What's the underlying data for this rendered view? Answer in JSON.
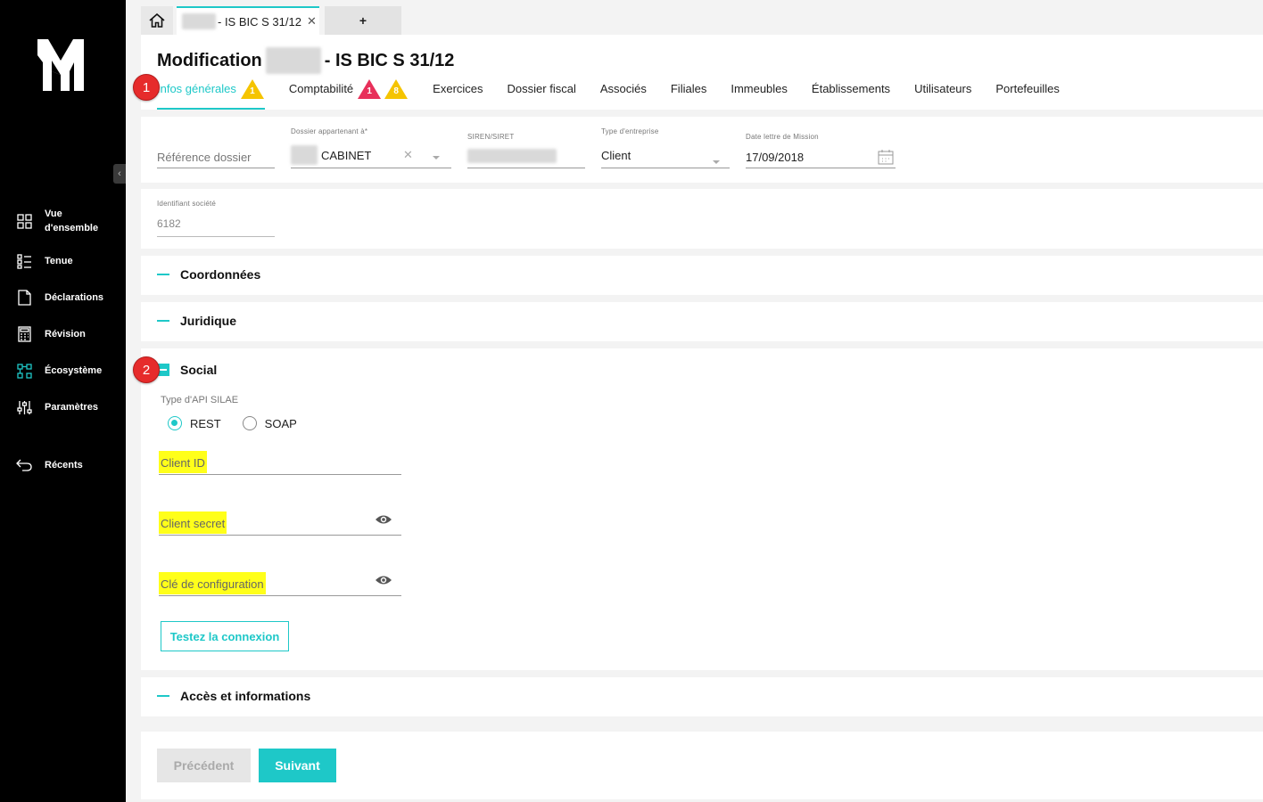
{
  "sidebar": {
    "items": [
      {
        "label": "Vue d'ensemble",
        "icon": "grid-icon"
      },
      {
        "label": "Tenue",
        "icon": "list-icon"
      },
      {
        "label": "Déclarations",
        "icon": "document-icon"
      },
      {
        "label": "Révision",
        "icon": "calculator-icon"
      },
      {
        "label": "Écosystème",
        "icon": "ecosystem-icon"
      },
      {
        "label": "Paramètres",
        "icon": "sliders-icon"
      },
      {
        "label": "Récents",
        "icon": "back-arrow-icon"
      }
    ]
  },
  "tabs": {
    "doc_tab_label": "- IS BIC S 31/12",
    "add_label": "+"
  },
  "header": {
    "title_prefix": "Modification",
    "title_suffix": "- IS BIC S 31/12",
    "subnav": [
      {
        "label": "Infos générales",
        "warning": "1"
      },
      {
        "label": "Comptabilité",
        "error": "1",
        "warning": "8"
      },
      {
        "label": "Exercices"
      },
      {
        "label": "Dossier fiscal"
      },
      {
        "label": "Associés"
      },
      {
        "label": "Filiales"
      },
      {
        "label": "Immeubles"
      },
      {
        "label": "Établissements"
      },
      {
        "label": "Utilisateurs"
      },
      {
        "label": "Portefeuilles"
      }
    ]
  },
  "badges": {
    "one": "1",
    "two": "2"
  },
  "form": {
    "reference": {
      "placeholder": "Référence dossier"
    },
    "dossier_appartenant": {
      "label": "Dossier appartenant à*",
      "value": "CABINET"
    },
    "siren": {
      "label": "SIREN/SIRET"
    },
    "type_entreprise": {
      "label": "Type d'entreprise",
      "value": "Client"
    },
    "date_lettre": {
      "label": "Date lettre de Mission",
      "value": "17/09/2018"
    },
    "identifiant": {
      "label": "Identifiant société",
      "value": "6182"
    }
  },
  "sections": {
    "coordonnees": "Coordonnées",
    "juridique": "Juridique",
    "social": "Social",
    "acces": "Accès et informations"
  },
  "social": {
    "api_label": "Type d'API SILAE",
    "options": [
      "REST",
      "SOAP"
    ],
    "selected": "REST",
    "client_id": "Client ID",
    "client_secret": "Client secret",
    "config_key": "Clé de configuration",
    "test_button": "Testez la connexion"
  },
  "footer": {
    "prev": "Précédent",
    "next": "Suivant"
  },
  "colors": {
    "accent": "#1ec8c8",
    "warning": "#f5c400",
    "error": "#e8305a",
    "badge": "#e62b2b",
    "highlight": "#ffff1a"
  }
}
